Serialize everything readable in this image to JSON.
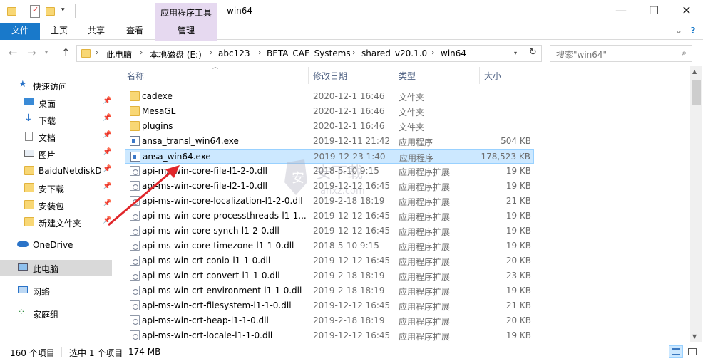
{
  "window": {
    "title": "win64",
    "context_group": "应用程序工具",
    "controls": {
      "minimize": "—",
      "maximize": "☐",
      "close": "✕"
    }
  },
  "ribbon": {
    "tabs": [
      "文件",
      "主页",
      "共享",
      "查看"
    ],
    "manage": "管理",
    "expand": "⌄",
    "help": "?"
  },
  "address": {
    "crumbs": [
      "此电脑",
      "本地磁盘 (E:)",
      "abc123",
      "BETA_CAE_Systems",
      "shared_v20.1.0",
      "win64"
    ],
    "search_placeholder": "搜索\"win64\""
  },
  "sidebar": {
    "items": [
      {
        "label": "快速访问",
        "icon": "star-icon",
        "pinned": false
      },
      {
        "label": "桌面",
        "icon": "desktop-icon",
        "pinned": true
      },
      {
        "label": "下载",
        "icon": "download-icon",
        "pinned": true
      },
      {
        "label": "文档",
        "icon": "document-icon",
        "pinned": true
      },
      {
        "label": "图片",
        "icon": "picture-icon",
        "pinned": true
      },
      {
        "label": "BaiduNetdiskD",
        "icon": "folder-icon",
        "pinned": true
      },
      {
        "label": "安下载",
        "icon": "folder-icon",
        "pinned": true
      },
      {
        "label": "安装包",
        "icon": "folder-icon",
        "pinned": true
      },
      {
        "label": "新建文件夹",
        "icon": "folder-icon",
        "pinned": true
      },
      {
        "label": "OneDrive",
        "icon": "cloud-icon",
        "pinned": false
      },
      {
        "label": "此电脑",
        "icon": "computer-icon",
        "pinned": false
      },
      {
        "label": "网络",
        "icon": "network-icon",
        "pinned": false
      },
      {
        "label": "家庭组",
        "icon": "homegroup-icon",
        "pinned": false
      }
    ]
  },
  "columns": {
    "name": "名称",
    "date": "修改日期",
    "type": "类型",
    "size": "大小"
  },
  "files": [
    {
      "name": "cadexe",
      "date": "2020-12-1 16:46",
      "type": "文件夹",
      "size": "",
      "kind": "folder"
    },
    {
      "name": "MesaGL",
      "date": "2020-12-1 16:46",
      "type": "文件夹",
      "size": "",
      "kind": "folder"
    },
    {
      "name": "plugins",
      "date": "2020-12-1 16:46",
      "type": "文件夹",
      "size": "",
      "kind": "folder"
    },
    {
      "name": "ansa_transl_win64.exe",
      "date": "2019-12-11 21:42",
      "type": "应用程序",
      "size": "504 KB",
      "kind": "exe"
    },
    {
      "name": "ansa_win64.exe",
      "date": "2019-12-23 1:40",
      "type": "应用程序",
      "size": "178,523 KB",
      "kind": "exe",
      "selected": true
    },
    {
      "name": "api-ms-win-core-file-l1-2-0.dll",
      "date": "2018-5-10 9:15",
      "type": "应用程序扩展",
      "size": "19 KB",
      "kind": "dll"
    },
    {
      "name": "api-ms-win-core-file-l2-1-0.dll",
      "date": "2019-12-12 16:45",
      "type": "应用程序扩展",
      "size": "19 KB",
      "kind": "dll"
    },
    {
      "name": "api-ms-win-core-localization-l1-2-0.dll",
      "date": "2019-2-18 18:19",
      "type": "应用程序扩展",
      "size": "21 KB",
      "kind": "dll"
    },
    {
      "name": "api-ms-win-core-processthreads-l1-1...",
      "date": "2019-12-12 16:45",
      "type": "应用程序扩展",
      "size": "19 KB",
      "kind": "dll"
    },
    {
      "name": "api-ms-win-core-synch-l1-2-0.dll",
      "date": "2019-12-12 16:45",
      "type": "应用程序扩展",
      "size": "19 KB",
      "kind": "dll"
    },
    {
      "name": "api-ms-win-core-timezone-l1-1-0.dll",
      "date": "2018-5-10 9:15",
      "type": "应用程序扩展",
      "size": "19 KB",
      "kind": "dll"
    },
    {
      "name": "api-ms-win-crt-conio-l1-1-0.dll",
      "date": "2019-12-12 16:45",
      "type": "应用程序扩展",
      "size": "20 KB",
      "kind": "dll"
    },
    {
      "name": "api-ms-win-crt-convert-l1-1-0.dll",
      "date": "2019-2-18 18:19",
      "type": "应用程序扩展",
      "size": "23 KB",
      "kind": "dll"
    },
    {
      "name": "api-ms-win-crt-environment-l1-1-0.dll",
      "date": "2019-2-18 18:19",
      "type": "应用程序扩展",
      "size": "19 KB",
      "kind": "dll"
    },
    {
      "name": "api-ms-win-crt-filesystem-l1-1-0.dll",
      "date": "2019-12-12 16:45",
      "type": "应用程序扩展",
      "size": "21 KB",
      "kind": "dll"
    },
    {
      "name": "api-ms-win-crt-heap-l1-1-0.dll",
      "date": "2019-2-18 18:19",
      "type": "应用程序扩展",
      "size": "20 KB",
      "kind": "dll"
    },
    {
      "name": "api-ms-win-crt-locale-l1-1-0.dll",
      "date": "2019-12-12 16:45",
      "type": "应用程序扩展",
      "size": "19 KB",
      "kind": "dll"
    }
  ],
  "status": {
    "count": "160 个项目",
    "selected": "选中 1 个项目",
    "size": "174 MB"
  },
  "watermark": {
    "line1": "安下载",
    "line2": "anxz.com"
  },
  "colors": {
    "accent": "#1979ca",
    "context": "#e6d9f0",
    "selection": "#cce8ff",
    "arrow": "#e0262a"
  }
}
